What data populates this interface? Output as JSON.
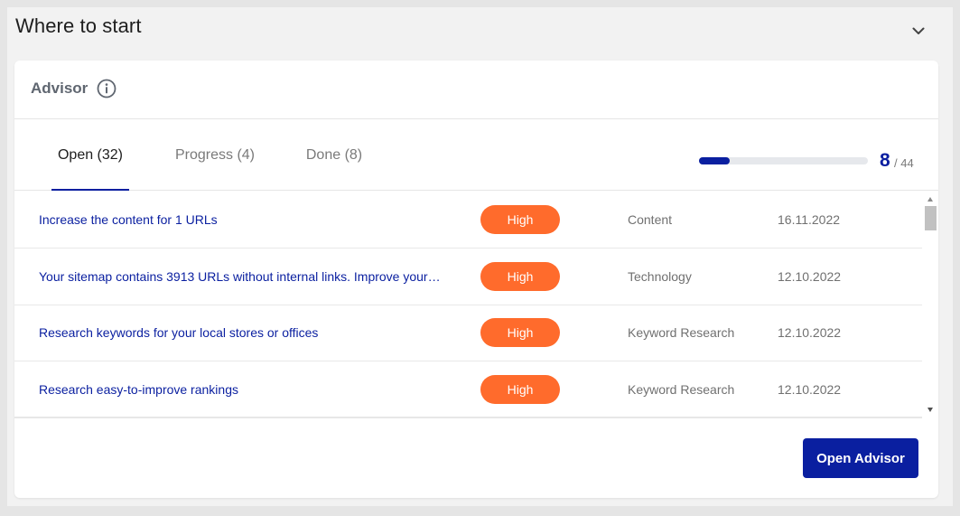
{
  "section": {
    "title": "Where to start",
    "collapse_icon": "chevron-down-icon"
  },
  "advisor": {
    "title": "Advisor",
    "info_icon": "info-icon",
    "tabs": [
      {
        "label": "Open (32)",
        "active": true
      },
      {
        "label": "Progress (4)",
        "active": false
      },
      {
        "label": "Done (8)",
        "active": false
      }
    ],
    "progress": {
      "done": "8",
      "total_label": "/ 44",
      "fraction": 0.182
    },
    "tasks": [
      {
        "title": "Increase the content for 1 URLs",
        "priority": "High",
        "category": "Content",
        "date": "16.11.2022"
      },
      {
        "title": "Your sitemap contains 3913 URLs without internal links. Improve your…",
        "priority": "High",
        "category": "Technology",
        "date": "12.10.2022"
      },
      {
        "title": "Research keywords for your local stores or offices",
        "priority": "High",
        "category": "Keyword Research",
        "date": "12.10.2022"
      },
      {
        "title": "Research easy-to-improve rankings",
        "priority": "High",
        "category": "Keyword Research",
        "date": "12.10.2022"
      }
    ],
    "open_button": "Open Advisor"
  },
  "colors": {
    "accent": "#0a1fa0",
    "priority_high": "#ff6b2c"
  }
}
